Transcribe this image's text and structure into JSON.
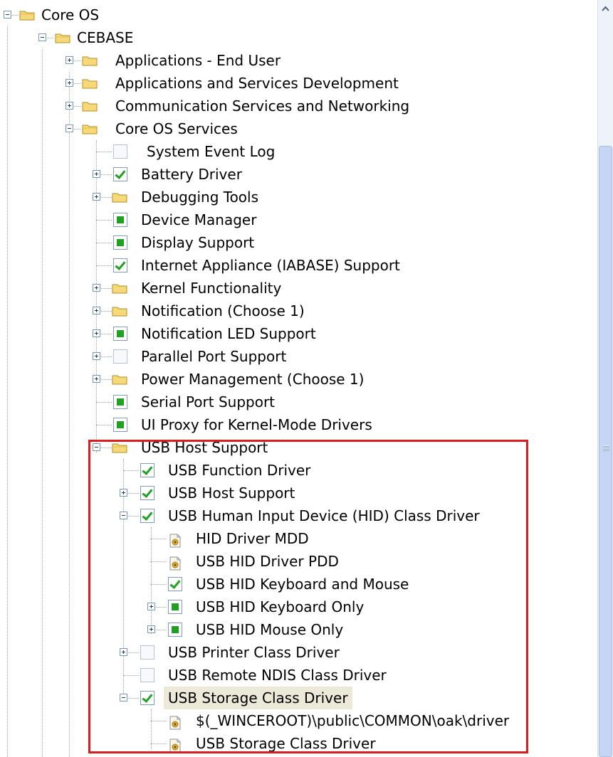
{
  "tree": {
    "core_os": "Core OS",
    "cebase": "CEBASE",
    "apps_end_user": "Applications - End User",
    "apps_services_dev": "Applications and Services Development",
    "comm_services": "Communication Services and Networking",
    "core_os_services": "Core OS Services",
    "system_event_log": "System Event Log",
    "battery_driver": "Battery Driver",
    "debugging_tools": "Debugging Tools",
    "device_manager": "Device Manager",
    "display_support": "Display Support",
    "internet_appliance": "Internet Appliance (IABASE) Support",
    "kernel_functionality": "Kernel Functionality",
    "notification": "Notification (Choose 1)",
    "notification_led": "Notification LED Support",
    "parallel_port": "Parallel Port Support",
    "power_management": "Power Management (Choose 1)",
    "serial_port": "Serial Port Support",
    "ui_proxy": "UI Proxy for Kernel-Mode Drivers",
    "usb_host_support_folder": "USB Host Support",
    "usb_function_driver": "USB Function Driver",
    "usb_host_support": "USB Host Support",
    "usb_hid_class_driver": "USB Human Input Device (HID) Class Driver",
    "hid_driver_mdd": "HID Driver MDD",
    "usb_hid_driver_pdd": "USB HID Driver PDD",
    "usb_hid_keyboard_mouse": "USB HID Keyboard and Mouse",
    "usb_hid_keyboard_only": "USB HID Keyboard Only",
    "usb_hid_mouse_only": "USB HID Mouse Only",
    "usb_printer_class": "USB Printer Class Driver",
    "usb_remote_ndis": "USB Remote NDIS Class Driver",
    "usb_storage_class": "USB Storage Class Driver",
    "wince_path": "$(_WINCEROOT)\\public\\COMMON\\oak\\driver",
    "usb_storage_class_file": "USB Storage Class Driver"
  },
  "colors": {
    "highlight_box": "#dd1c1c",
    "check_green": "#21a121",
    "folder_yellow": "#f5d97a",
    "selected_bg": "#ece9d8",
    "scrollbar_thumb": "#c4d6f3"
  }
}
